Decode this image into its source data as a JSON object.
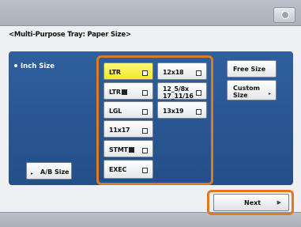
{
  "title": "<Multi-Purpose Tray: Paper Size>",
  "inch_size_label": "Inch Size",
  "ab_size_label": "A/B Size",
  "sizes": {
    "ltr": "LTR",
    "ltrr": "LTR",
    "lgl": "LGL",
    "s11x17": "11x17",
    "stmtr": "STMT",
    "exec": "EXEC",
    "s12x18": "12x18",
    "s12_5": "12_5/8x\n17_11/16",
    "s13x19": "13x19"
  },
  "free_size_label": "Free Size",
  "custom_size_label": "Custom\nSize",
  "next_label": "Next",
  "selected": "LTR",
  "colors": {
    "accent_orange": "#e07a1e",
    "band_blue": "#2a5793",
    "selected_yellow": "#f6ee3e"
  }
}
